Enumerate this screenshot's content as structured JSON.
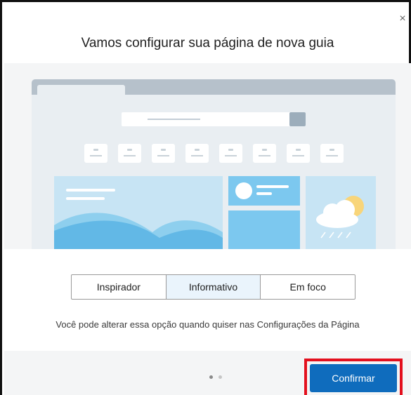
{
  "dialog": {
    "title": "Vamos configurar sua página de nova guia",
    "close_glyph": "×"
  },
  "layouts": [
    {
      "label": "Inspirador",
      "selected": false
    },
    {
      "label": "Informativo",
      "selected": true
    },
    {
      "label": "Em foco",
      "selected": false
    }
  ],
  "hint": "Você pode alterar essa opção quando quiser nas Configurações da Página",
  "pagination": {
    "pages": 2,
    "current": 1
  },
  "confirm_label": "Confirmar",
  "colors": {
    "accent": "#0f6cbd",
    "highlight": "#e3101e",
    "selected_segment": "#eaf4fc"
  }
}
